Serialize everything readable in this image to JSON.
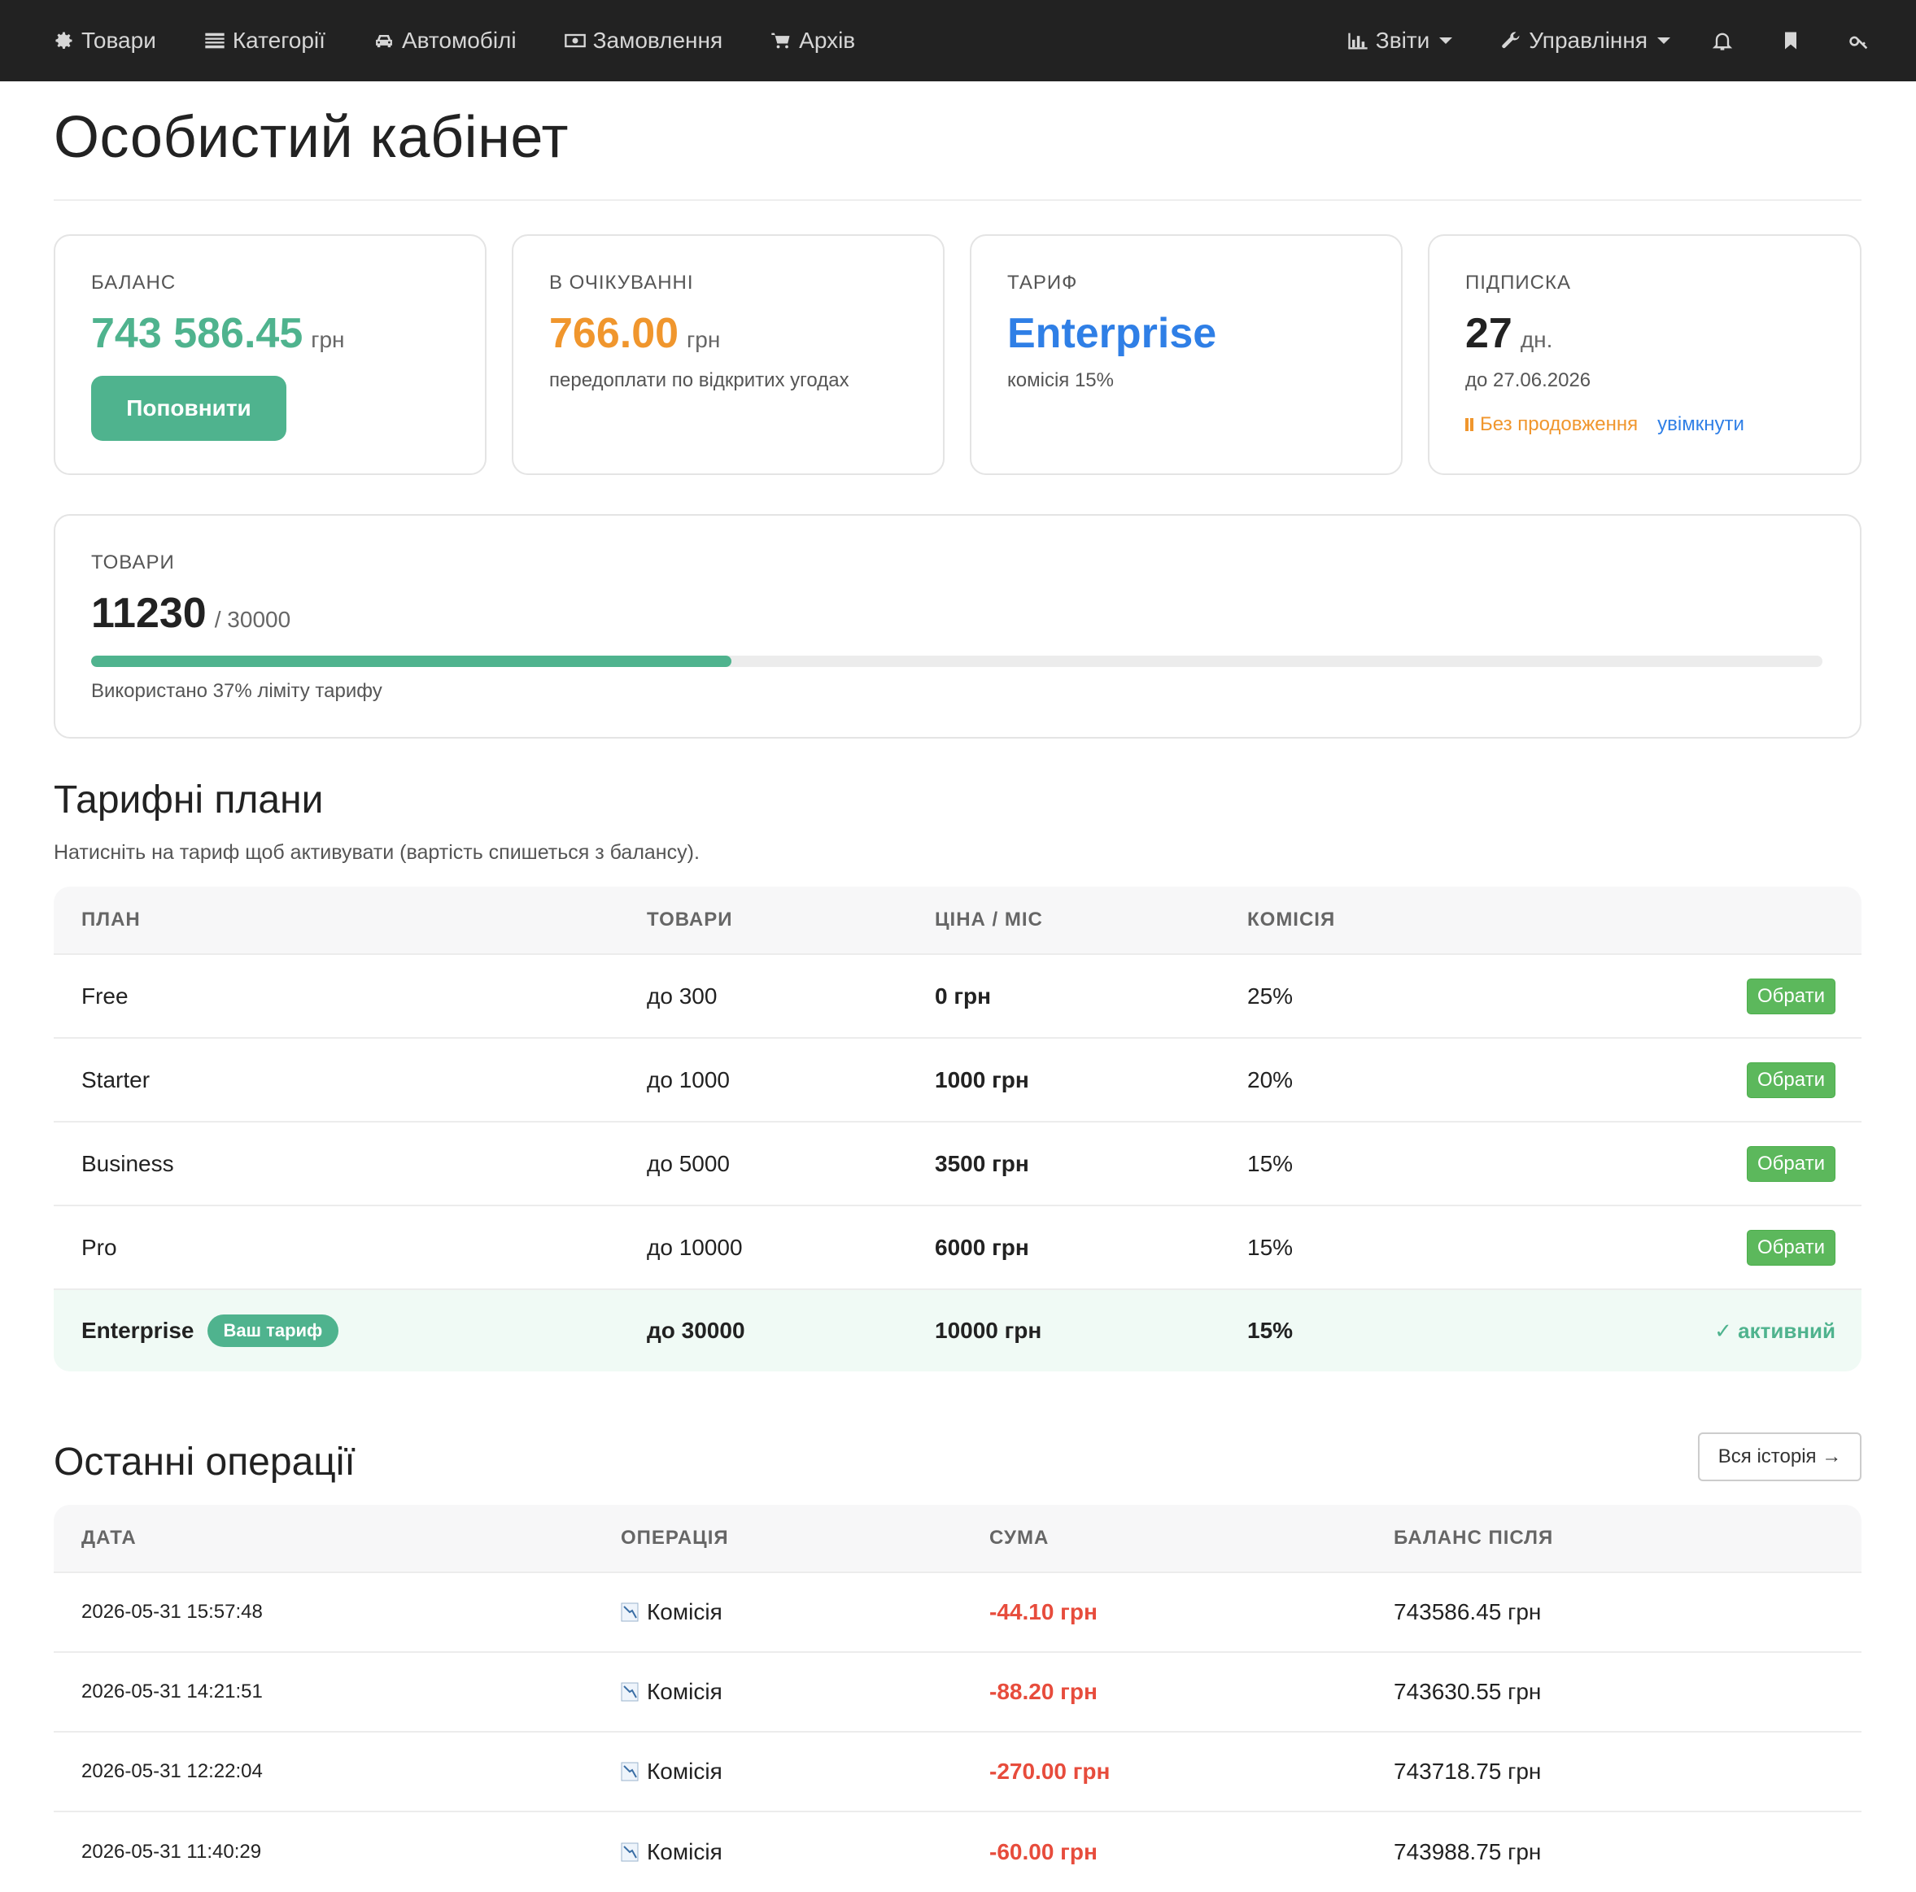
{
  "nav": {
    "left": [
      {
        "label": "Товари",
        "icon": "gear-icon"
      },
      {
        "label": "Категорії",
        "icon": "list-icon"
      },
      {
        "label": "Автомобілі",
        "icon": "car-icon"
      },
      {
        "label": "Замовлення",
        "icon": "money-icon"
      },
      {
        "label": "Архів",
        "icon": "cart-icon"
      }
    ],
    "right": [
      {
        "label": "Звіти",
        "icon": "bar-chart-icon"
      },
      {
        "label": "Управління",
        "icon": "wrench-icon"
      }
    ],
    "icons": [
      "bell-icon",
      "bookmark-icon",
      "key-icon"
    ]
  },
  "page": {
    "title": "Особистий кабінет"
  },
  "stats": {
    "balance": {
      "label": "БАЛАНС",
      "value": "743 586.45",
      "unit": "грн",
      "button": "Поповнити",
      "color": "#4fb38e"
    },
    "pending": {
      "label": "В ОЧІКУВАННІ",
      "value": "766.00",
      "unit": "грн",
      "note": "передоплати по відкритих угодах",
      "color": "#f0962d"
    },
    "tariff": {
      "label": "ТАРИФ",
      "value": "Enterprise",
      "note": "комісія 15%",
      "color": "#2f7fe6"
    },
    "subscription": {
      "label": "ПІДПИСКА",
      "value": "27",
      "unit": "дн.",
      "until": "до 27.06.2026",
      "no_renew": "Без продовження",
      "enable": "увімкнути"
    }
  },
  "products": {
    "label": "ТОВАРИ",
    "used": "11230",
    "limit": "/ 30000",
    "usage_fraction": 0.37,
    "note": "Використано 37% ліміту тарифу"
  },
  "plans": {
    "title": "Тарифні плани",
    "desc": "Натисніть на тариф щоб активувати (вартість спишеться з балансу).",
    "headers": [
      "ПЛАН",
      "ТОВАРИ",
      "ЦІНА / МІС",
      "КОМІСІЯ"
    ],
    "choose_label": "Обрати",
    "current_badge": "Ваш тариф",
    "active_label": "✓ активний",
    "rows": [
      {
        "name": "Free",
        "products": "до 300",
        "price": "0 грн",
        "commission": "25%"
      },
      {
        "name": "Starter",
        "products": "до 1000",
        "price": "1000 грн",
        "commission": "20%"
      },
      {
        "name": "Business",
        "products": "до 5000",
        "price": "3500 грн",
        "commission": "15%"
      },
      {
        "name": "Pro",
        "products": "до 10000",
        "price": "6000 грн",
        "commission": "15%"
      },
      {
        "name": "Enterprise",
        "products": "до 30000",
        "price": "10000 грн",
        "commission": "15%"
      }
    ]
  },
  "operations": {
    "title": "Останні операції",
    "history_button": "Вся історія →",
    "headers": [
      "ДАТА",
      "ОПЕРАЦІЯ",
      "СУМА",
      "БАЛАНС ПІСЛЯ"
    ],
    "rows": [
      {
        "date": "2026-05-31 15:57:48",
        "op": "Комісія",
        "amount": "-44.10 грн",
        "balance": "743586.45 грн"
      },
      {
        "date": "2026-05-31 14:21:51",
        "op": "Комісія",
        "amount": "-88.20 грн",
        "balance": "743630.55 грн"
      },
      {
        "date": "2026-05-31 12:22:04",
        "op": "Комісія",
        "amount": "-270.00 грн",
        "balance": "743718.75 грн"
      },
      {
        "date": "2026-05-31 11:40:29",
        "op": "Комісія",
        "amount": "-60.00 грн",
        "balance": "743988.75 грн"
      }
    ]
  }
}
